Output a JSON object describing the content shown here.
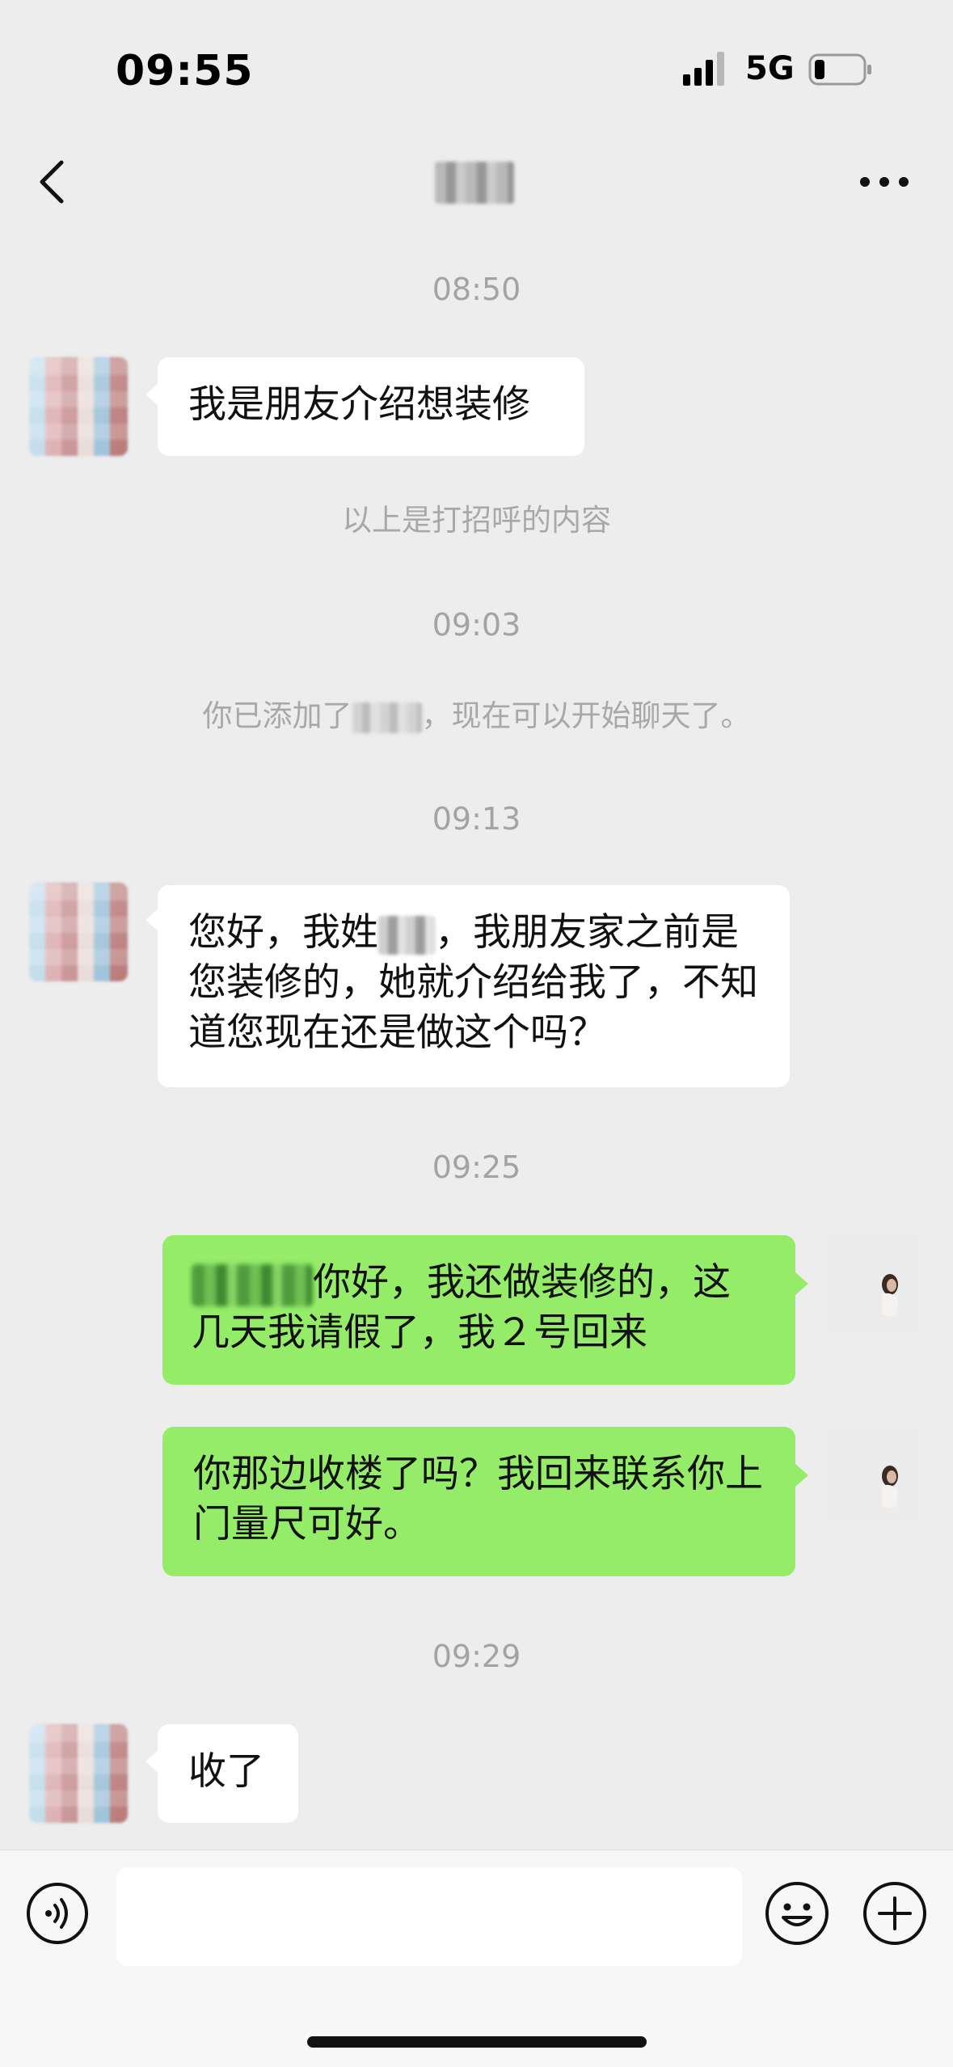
{
  "status_bar": {
    "time": "09:55",
    "network": "5G"
  },
  "nav": {
    "title": "",
    "back_icon": "chevron-left-icon",
    "more_icon": "more-icon"
  },
  "messages": {
    "t1": "08:50",
    "m1": "我是朋友介绍想装修",
    "greeting_tip": "以上是打招呼的内容",
    "t2": "09:03",
    "added_prefix": "你已添加了",
    "added_suffix": "，现在可以开始聊天了。",
    "t3": "09:13",
    "m2_a": "您好，我姓",
    "m2_b": "，我朋友家之前是您装修的，她就介绍给我了，不知道您现在还是做这个吗？",
    "t4": "09:25",
    "m3": "你好，我还做装修的，这几天我请假了，我２号回来",
    "m4": "你那边收楼了吗？我回来联系你上门量尺可好。",
    "t5": "09:29",
    "m5": "收了"
  },
  "input_bar": {
    "voice_icon": "voice-icon",
    "emoji_icon": "emoji-icon",
    "plus_icon": "plus-icon",
    "text_value": ""
  },
  "colors": {
    "background": "#ededed",
    "bubble_in": "#ffffff",
    "bubble_out": "#95ec69",
    "system_text": "#a3a3a3"
  }
}
